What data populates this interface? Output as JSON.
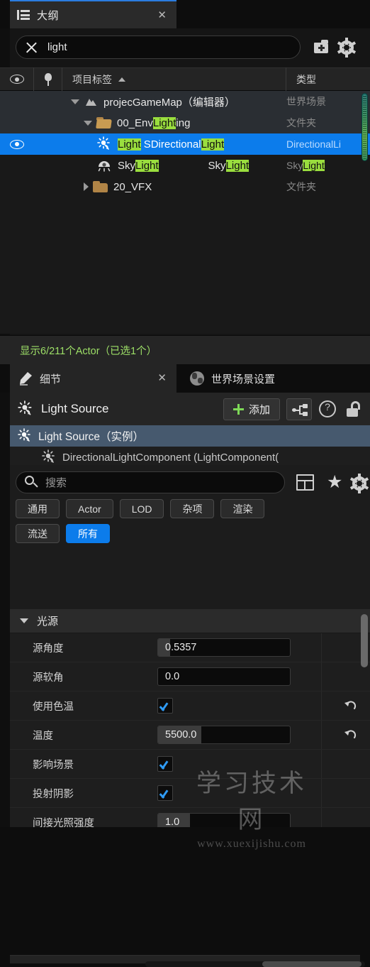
{
  "outliner": {
    "tab": {
      "label": "大纲",
      "icon": "outliner-icon",
      "close": "✕"
    },
    "search": {
      "value": "light",
      "clear_icon": "clear-x-icon",
      "add_folder_icon": "add-folder-icon",
      "settings_icon": "gear-icon"
    },
    "columns": {
      "visibility": "eye-icon",
      "pin": "pin-icon",
      "label": "项目标签",
      "sort": "▲",
      "type": "类型"
    },
    "rows": [
      {
        "indent": 1,
        "caret": "down",
        "icon": "map-icon",
        "name_plain": "projecGameMap（编辑器）",
        "type": "世界场景",
        "selected": false,
        "visible_toggle": false
      },
      {
        "indent": 2,
        "caret": "down",
        "icon": "folder-open-icon",
        "name_pre": "00_Env",
        "name_hl": "Light",
        "name_post": "ing",
        "type": "文件夹",
        "selected": false,
        "visible_toggle": false
      },
      {
        "indent": 3,
        "caret": "none",
        "icon": "directional-light-icon",
        "name_hl": "Light",
        "name_post": " SDirectional",
        "name_hl2": "Light",
        "type": "DirectionalLi",
        "selected": true,
        "visible_toggle": true
      },
      {
        "indent": 3,
        "caret": "none",
        "icon": "sky-light-icon",
        "name_pre": "Sky",
        "name_hl": "Light",
        "type_pre": "Sky",
        "type_hl": "Light",
        "mid_pre": "Sky",
        "mid_hl": "Light",
        "selected": false,
        "visible_toggle": false
      },
      {
        "indent": 2,
        "caret": "right",
        "icon": "folder-icon",
        "name_plain": "20_VFX",
        "type": "文件夹",
        "selected": false,
        "visible_toggle": false
      }
    ],
    "status": "显示6/211个Actor（已选1个）"
  },
  "details": {
    "tabs": [
      {
        "label": "细节",
        "icon": "pencil-icon",
        "active": true,
        "close": "✕"
      },
      {
        "label": "世界场景设置",
        "icon": "globe-icon",
        "active": false
      }
    ],
    "header": {
      "icon": "directional-light-icon",
      "title": "Light Source",
      "add_label": "添加",
      "add_icon": "plus-icon",
      "blueprint_icon": "blueprint-graph-icon",
      "help_icon": "help-circle-icon",
      "lock_icon": "unlock-icon"
    },
    "components": [
      {
        "label": "Light Source（实例）",
        "icon": "directional-light-icon",
        "selected": true,
        "sub": false
      },
      {
        "label": "DirectionalLightComponent (LightComponent(",
        "icon": "directional-light-icon",
        "selected": false,
        "sub": true
      }
    ],
    "search": {
      "placeholder": "搜索",
      "icon": "search-icon",
      "layout_icon": "table-layout-icon",
      "favorite_icon": "star-icon",
      "settings_icon": "gear-icon"
    },
    "filters": [
      {
        "label": "通用",
        "active": false
      },
      {
        "label": "Actor",
        "active": false
      },
      {
        "label": "LOD",
        "active": false
      },
      {
        "label": "杂项",
        "active": false
      },
      {
        "label": "渲染",
        "active": false
      },
      {
        "label": "流送",
        "active": false
      },
      {
        "label": "所有",
        "active": true
      }
    ],
    "section": {
      "title": "光源",
      "expanded": true
    },
    "properties": [
      {
        "label": "源角度",
        "type": "number",
        "value": "0.5357",
        "fill_pct": 9,
        "reset": false
      },
      {
        "label": "源软角",
        "type": "number",
        "value": "0.0",
        "fill_pct": 0,
        "reset": false
      },
      {
        "label": "使用色温",
        "type": "checkbox",
        "checked": true,
        "reset": true
      },
      {
        "label": "温度",
        "type": "number",
        "value": "5500.0",
        "fill_pct": 33,
        "reset": true
      },
      {
        "label": "影响场景",
        "type": "checkbox",
        "checked": true,
        "reset": false
      },
      {
        "label": "投射阴影",
        "type": "checkbox",
        "checked": true,
        "reset": false
      },
      {
        "label": "间接光照强度",
        "type": "number",
        "value": "1.0",
        "fill_pct": 24,
        "reset": false
      }
    ]
  },
  "watermark": {
    "main": "学习技术网",
    "url": "www.xuexijishu.com"
  },
  "colors": {
    "accent": "#0c7ceb",
    "highlight": "#9ade3e",
    "status": "#9ddf67",
    "green_plus": "#7ed957"
  }
}
